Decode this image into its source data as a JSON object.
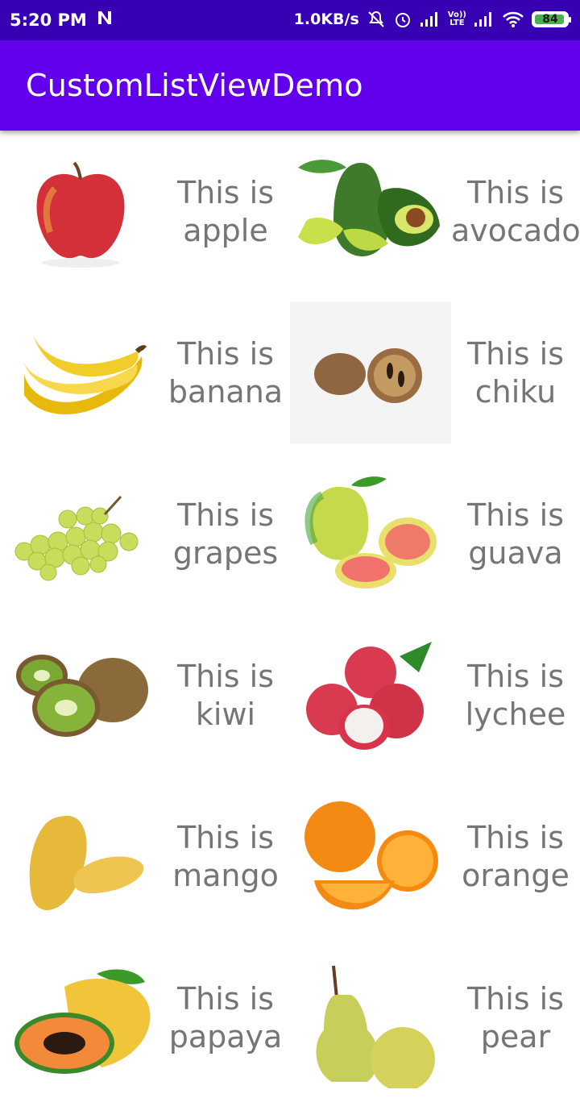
{
  "status_bar": {
    "time": "5:20 PM",
    "notification_icon": "n-logo-icon",
    "speed": "1.0KB/s",
    "lte_top": "Vo))",
    "lte_bottom": "LTE",
    "battery": "84"
  },
  "app_bar": {
    "title": "CustomListViewDemo"
  },
  "items": [
    {
      "line1": "This is",
      "line2": "apple",
      "icon": "apple-icon"
    },
    {
      "line1": "This is",
      "line2": "avocado",
      "icon": "avocado-icon"
    },
    {
      "line1": "This is",
      "line2": "banana",
      "icon": "banana-icon"
    },
    {
      "line1": "This is",
      "line2": "chiku",
      "icon": "chiku-icon"
    },
    {
      "line1": "This is",
      "line2": "grapes",
      "icon": "grapes-icon"
    },
    {
      "line1": "This is",
      "line2": "guava",
      "icon": "guava-icon"
    },
    {
      "line1": "This is",
      "line2": "kiwi",
      "icon": "kiwi-icon"
    },
    {
      "line1": "This is",
      "line2": "lychee",
      "icon": "lychee-icon"
    },
    {
      "line1": "This is",
      "line2": "mango",
      "icon": "mango-icon"
    },
    {
      "line1": "This is",
      "line2": "orange",
      "icon": "orange-icon"
    },
    {
      "line1": "This is",
      "line2": "papaya",
      "icon": "papaya-icon"
    },
    {
      "line1": "This is",
      "line2": "pear",
      "icon": "pear-icon"
    }
  ]
}
